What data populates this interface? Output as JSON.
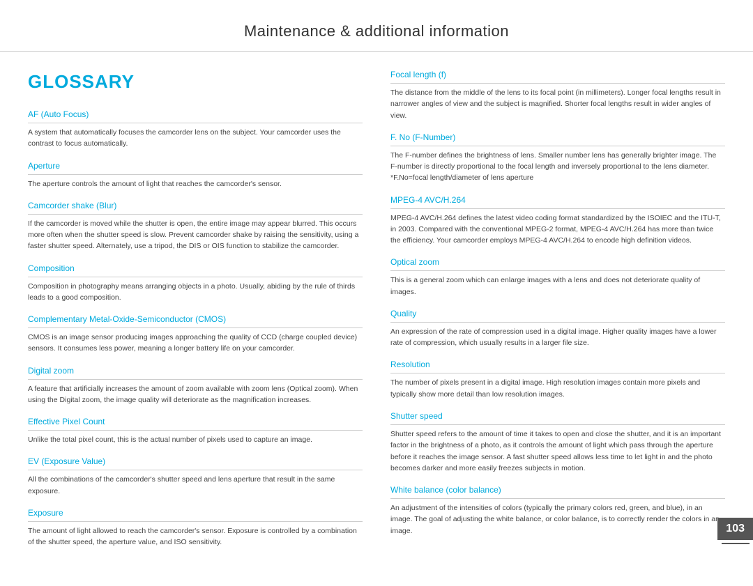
{
  "header": {
    "title": "Maintenance & additional information"
  },
  "left": {
    "glossary_title": "GLOSSARY",
    "terms": [
      {
        "heading": "AF (Auto Focus)",
        "body": "A system that automatically focuses the camcorder lens on the subject. Your camcorder uses the contrast to focus automatically."
      },
      {
        "heading": "Aperture",
        "body": "The aperture controls the amount of light that reaches the camcorder's sensor."
      },
      {
        "heading": "Camcorder shake (Blur)",
        "body": "If the camcorder is moved while the shutter is open, the entire image may appear blurred. This occurs more often when the shutter speed is slow. Prevent camcorder shake by raising the sensitivity, using a faster shutter speed. Alternately, use a tripod, the DIS or OIS function to stabilize the camcorder."
      },
      {
        "heading": "Composition",
        "body": "Composition in photography means arranging objects in a photo. Usually, abiding by the rule of thirds leads to a good composition."
      },
      {
        "heading": "Complementary Metal-Oxide-Semiconductor (CMOS)",
        "body": "CMOS is an image sensor producing images approaching the quality of CCD (charge coupled device) sensors. It consumes less power, meaning a longer battery life on your camcorder."
      },
      {
        "heading": "Digital zoom",
        "body": "A feature that artificially increases the amount of zoom available with zoom lens (Optical zoom). When using the Digital zoom, the image quality will deteriorate as the magnification increases."
      },
      {
        "heading": "Effective Pixel Count",
        "body": "Unlike the total pixel count, this is the actual number of pixels used to capture an image."
      },
      {
        "heading": "EV (Exposure Value)",
        "body": "All the combinations of the camcorder's shutter speed and lens aperture that result in the same exposure."
      },
      {
        "heading": "Exposure",
        "body": "The amount of light allowed to reach the camcorder's sensor. Exposure is controlled by a combination of the shutter speed, the aperture value, and ISO sensitivity."
      }
    ]
  },
  "right": {
    "terms": [
      {
        "heading": "Focal length (f)",
        "body": "The distance from the middle of the lens to its focal point (in millimeters). Longer focal lengths result in narrower angles of view and the subject is magnified. Shorter focal lengths result in wider angles of view."
      },
      {
        "heading": "F. No (F-Number)",
        "body": "The F-number defines the brightness of lens. Smaller number lens has generally brighter image. The F-number is directly proportional to the focal length and inversely proportional to the lens diameter.\n*F.No=focal length/diameter of lens aperture"
      },
      {
        "heading": "MPEG-4 AVC/H.264",
        "body": "MPEG-4 AVC/H.264 defines the latest video coding format standardized by the ISOIEC and the ITU-T, in 2003. Compared with the conventional MPEG-2 format, MPEG-4 AVC/H.264 has more than twice the efficiency. Your camcorder employs MPEG-4 AVC/H.264 to encode high definition videos."
      },
      {
        "heading": "Optical zoom",
        "body": "This is a general zoom which can enlarge images with a lens and does not deteriorate quality of images."
      },
      {
        "heading": "Quality",
        "body": "An expression of the rate of compression used in a digital image. Higher quality images have a lower rate of compression, which usually results in a larger file size."
      },
      {
        "heading": "Resolution",
        "body": "The number of pixels present in a digital image. High resolution images contain more pixels and typically show more detail than low resolution images."
      },
      {
        "heading": "Shutter speed",
        "body": "Shutter speed refers to the amount of time it takes to open and close the shutter, and it is an important factor in the brightness of a photo, as it controls the amount of light which pass through the aperture before it reaches the image sensor. A fast shutter speed allows less time to let light in and the photo becomes darker and more easily freezes subjects in motion."
      },
      {
        "heading": "White balance (color balance)",
        "body": "An adjustment of the intensities of colors (typically the primary colors red, green, and blue), in an image. The goal of adjusting the white balance, or color balance, is to correctly render the colors in an image."
      }
    ]
  },
  "page_number": "103"
}
